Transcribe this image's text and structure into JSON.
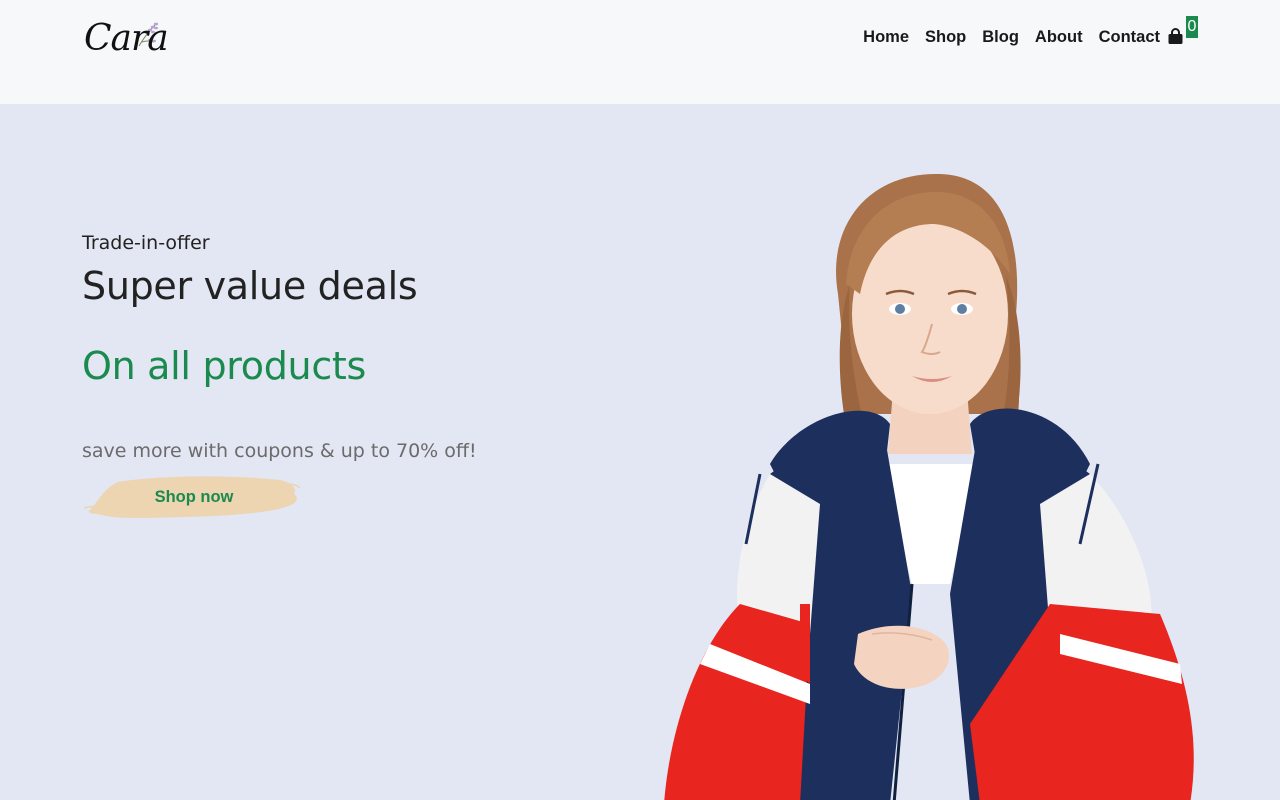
{
  "brand": {
    "logo_text": "Cara",
    "icon": "lavender-sprig-icon"
  },
  "nav": {
    "items": [
      {
        "label": "Home"
      },
      {
        "label": "Shop"
      },
      {
        "label": "Blog"
      },
      {
        "label": "About"
      },
      {
        "label": "Contact"
      }
    ],
    "cart": {
      "icon": "shopping-bag-icon",
      "count": "0"
    }
  },
  "hero": {
    "tagline": "Trade-in-offer",
    "headline": "Super value deals",
    "subheadline": "On all products",
    "promo": "save more with coupons & up to 70% off!",
    "cta_label": "Shop now",
    "image": "model-in-windbreaker-jacket"
  },
  "colors": {
    "accent": "#1a8a4f",
    "hero_bg": "#e3e6f3",
    "header_bg": "#f6f8fa",
    "button_brush": "#ecd5b0"
  }
}
